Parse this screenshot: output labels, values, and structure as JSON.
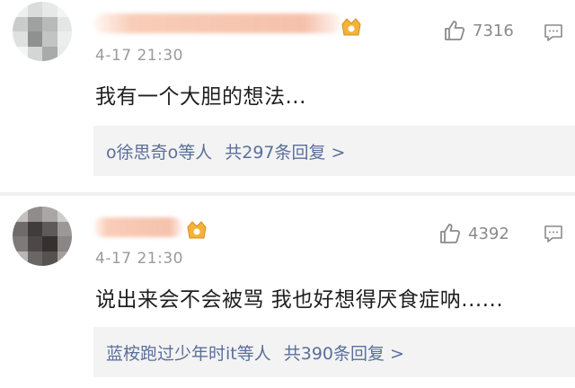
{
  "comments": [
    {
      "time": "4-17 21:30",
      "likes": "7316",
      "text": "我有一个大胆的想法...",
      "reply_users": "o徐思奇o等人",
      "reply_count": "共297条回复 >"
    },
    {
      "time": "4-17 21:30",
      "likes": "4392",
      "text": "说出来会不会被骂 我也好想得厌食症呐......",
      "reply_users": "蓝桉跑过少年时it等人",
      "reply_count": "共390条回复 >"
    }
  ],
  "colors": {
    "link": "#5a6f9a",
    "meta": "#9a9a9a",
    "reply_bg": "#f3f3f3"
  },
  "icons": [
    "thumbs-up-icon",
    "reply-icon",
    "vip-badge-icon"
  ]
}
